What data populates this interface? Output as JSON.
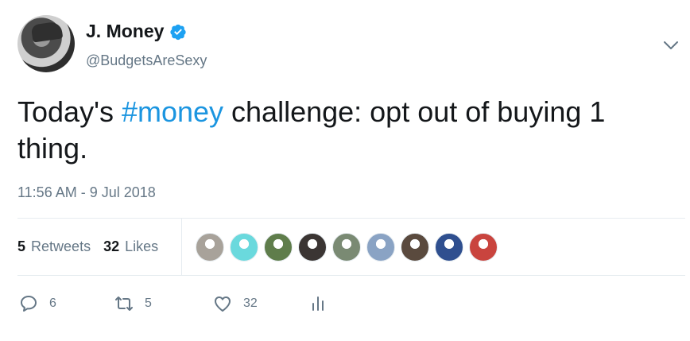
{
  "author": {
    "display_name": "J. Money",
    "handle": "@BudgetsAreSexy",
    "verified": true
  },
  "tweet": {
    "text_before": "Today's ",
    "hashtag": "#money",
    "text_after": " challenge: opt out of buying 1 thing.",
    "timestamp": "11:56 AM - 9 Jul 2018"
  },
  "stats": {
    "retweets_count": "5",
    "retweets_label": "Retweets",
    "likes_count": "32",
    "likes_label": "Likes"
  },
  "likers": [
    {
      "color": "#a8a29a",
      "icon": "avatar"
    },
    {
      "color": "#6ad9dd",
      "icon": "avatar"
    },
    {
      "color": "#5f7d4b",
      "icon": "avatar"
    },
    {
      "color": "#3b3533",
      "icon": "avatar"
    },
    {
      "color": "#7a8a73",
      "icon": "avatar"
    },
    {
      "color": "#8aa3c4",
      "icon": "avatar"
    },
    {
      "color": "#5a4a3e",
      "icon": "avatar"
    },
    {
      "color": "#2f4f8f",
      "icon": "avatar"
    },
    {
      "color": "#c9443e",
      "icon": "avatar"
    }
  ],
  "actions": {
    "reply_count": "6",
    "retweet_count": "5",
    "like_count": "32"
  },
  "colors": {
    "accent": "#1b95e0",
    "verified": "#1da1f2",
    "muted": "#657786"
  }
}
